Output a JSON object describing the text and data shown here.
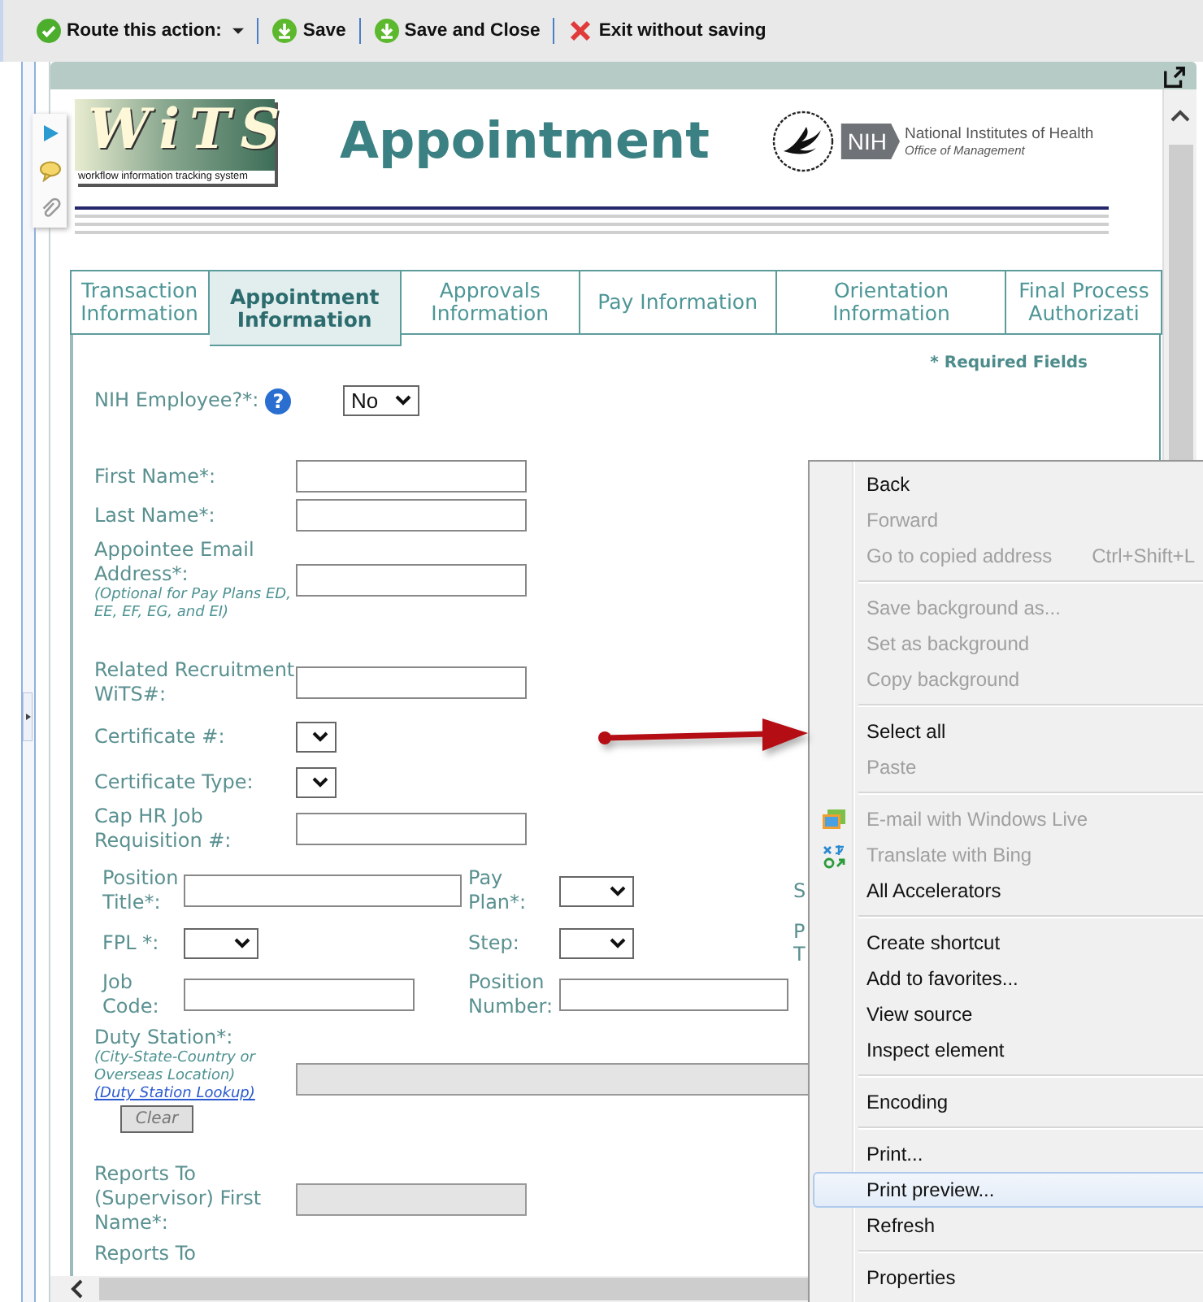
{
  "toolbar": [
    {
      "kind": "route",
      "label": "Route this action:"
    },
    {
      "kind": "save",
      "label": "Save"
    },
    {
      "kind": "save",
      "label": "Save and Close"
    },
    {
      "kind": "exit",
      "label": "Exit without saving"
    }
  ],
  "header": {
    "logo": "WiTS",
    "logo_caption": "workflow information tracking system",
    "title": "Appointment",
    "badge": "NIH",
    "agency": "National Institutes of Health",
    "office": "Office of Management"
  },
  "tabs": [
    {
      "label": "Transaction Information",
      "selected": false
    },
    {
      "label": "Appointment Information",
      "selected": true
    },
    {
      "label": "Approvals Information",
      "selected": false
    },
    {
      "label": "Pay Information",
      "selected": false
    },
    {
      "label": "Orientation Information",
      "selected": false
    },
    {
      "label": "Final Process Authorizati",
      "selected": false
    }
  ],
  "form": {
    "required_note": "* Required Fields",
    "fields": [
      {
        "label": "NIH Employee?*:",
        "help": "?",
        "kind": "select",
        "value": "No"
      },
      {
        "label": "First Name*:",
        "kind": "text"
      },
      {
        "label": "Last Name*:",
        "kind": "text"
      },
      {
        "label": "Appointee Email Address*:",
        "note": "(Optional for Pay Plans ED, EE, EF, EG, and EI)",
        "kind": "text"
      },
      {
        "label": "Related Recruitment WiTS#:",
        "kind": "text"
      },
      {
        "label": "Certificate #:",
        "kind": "select"
      },
      {
        "label": "Certificate Type:",
        "kind": "select"
      },
      {
        "label": "Cap HR Job Requisition #:",
        "kind": "text"
      }
    ],
    "position_grid": [
      [
        {
          "label": "Position Title*:",
          "kind": "text"
        },
        {
          "label": "Pay Plan*:",
          "kind": "select"
        },
        {
          "label": "S",
          "kind": "label"
        }
      ],
      [
        {
          "label": "FPL *:",
          "kind": "select"
        },
        {
          "label": "Step:",
          "kind": "select"
        },
        {
          "label": "P T",
          "kind": "label"
        }
      ],
      [
        {
          "label": "Job Code:",
          "kind": "text"
        },
        {
          "label": "Position Number:",
          "kind": "text"
        }
      ]
    ],
    "duty_station": {
      "label": "Duty Station*:",
      "note": "(City-State-Country or Overseas Location)",
      "link": "(Duty Station Lookup)",
      "button": "Clear",
      "disabled": true
    },
    "supervisor_field": {
      "label": "Reports To (Supervisor) First Name*:",
      "disabled": true
    },
    "trailing_label": "Reports To"
  },
  "context_menu": {
    "groups": [
      [
        {
          "kind": "plain",
          "label": "Back",
          "disabled": false,
          "selected": false
        },
        {
          "kind": "plain",
          "label": "Forward",
          "disabled": true,
          "selected": false
        },
        {
          "kind": "plain",
          "label": "Go to copied address",
          "shortcut": "Ctrl+Shift+L",
          "disabled": true,
          "selected": false
        }
      ],
      [
        {
          "kind": "plain",
          "label": "Save background as...",
          "disabled": true,
          "selected": false
        },
        {
          "kind": "plain",
          "label": "Set as background",
          "disabled": true,
          "selected": false
        },
        {
          "kind": "plain",
          "label": "Copy background",
          "disabled": true,
          "selected": false
        }
      ],
      [
        {
          "kind": "plain",
          "label": "Select all",
          "disabled": false,
          "selected": false
        },
        {
          "kind": "plain",
          "label": "Paste",
          "disabled": true,
          "selected": false
        }
      ],
      [
        {
          "kind": "mail",
          "label": "E-mail with Windows Live",
          "disabled": true,
          "selected": false
        },
        {
          "kind": "translate",
          "label": "Translate with Bing",
          "disabled": true,
          "selected": false
        },
        {
          "kind": "plain",
          "label": "All Accelerators",
          "disabled": false,
          "selected": false
        }
      ],
      [
        {
          "kind": "plain",
          "label": "Create shortcut",
          "disabled": false,
          "selected": false
        },
        {
          "kind": "plain",
          "label": "Add to favorites...",
          "disabled": false,
          "selected": false
        },
        {
          "kind": "plain",
          "label": "View source",
          "disabled": false,
          "selected": false
        },
        {
          "kind": "plain",
          "label": "Inspect element",
          "disabled": false,
          "selected": false
        }
      ],
      [
        {
          "kind": "plain",
          "label": "Encoding",
          "disabled": false,
          "selected": false
        }
      ],
      [
        {
          "kind": "plain",
          "label": "Print...",
          "disabled": false,
          "selected": false
        },
        {
          "kind": "plain",
          "label": "Print preview...",
          "disabled": false,
          "selected": true
        },
        {
          "kind": "plain",
          "label": "Refresh",
          "disabled": false,
          "selected": false
        }
      ],
      [
        {
          "kind": "plain",
          "label": "Properties",
          "disabled": false,
          "selected": false
        }
      ]
    ]
  }
}
